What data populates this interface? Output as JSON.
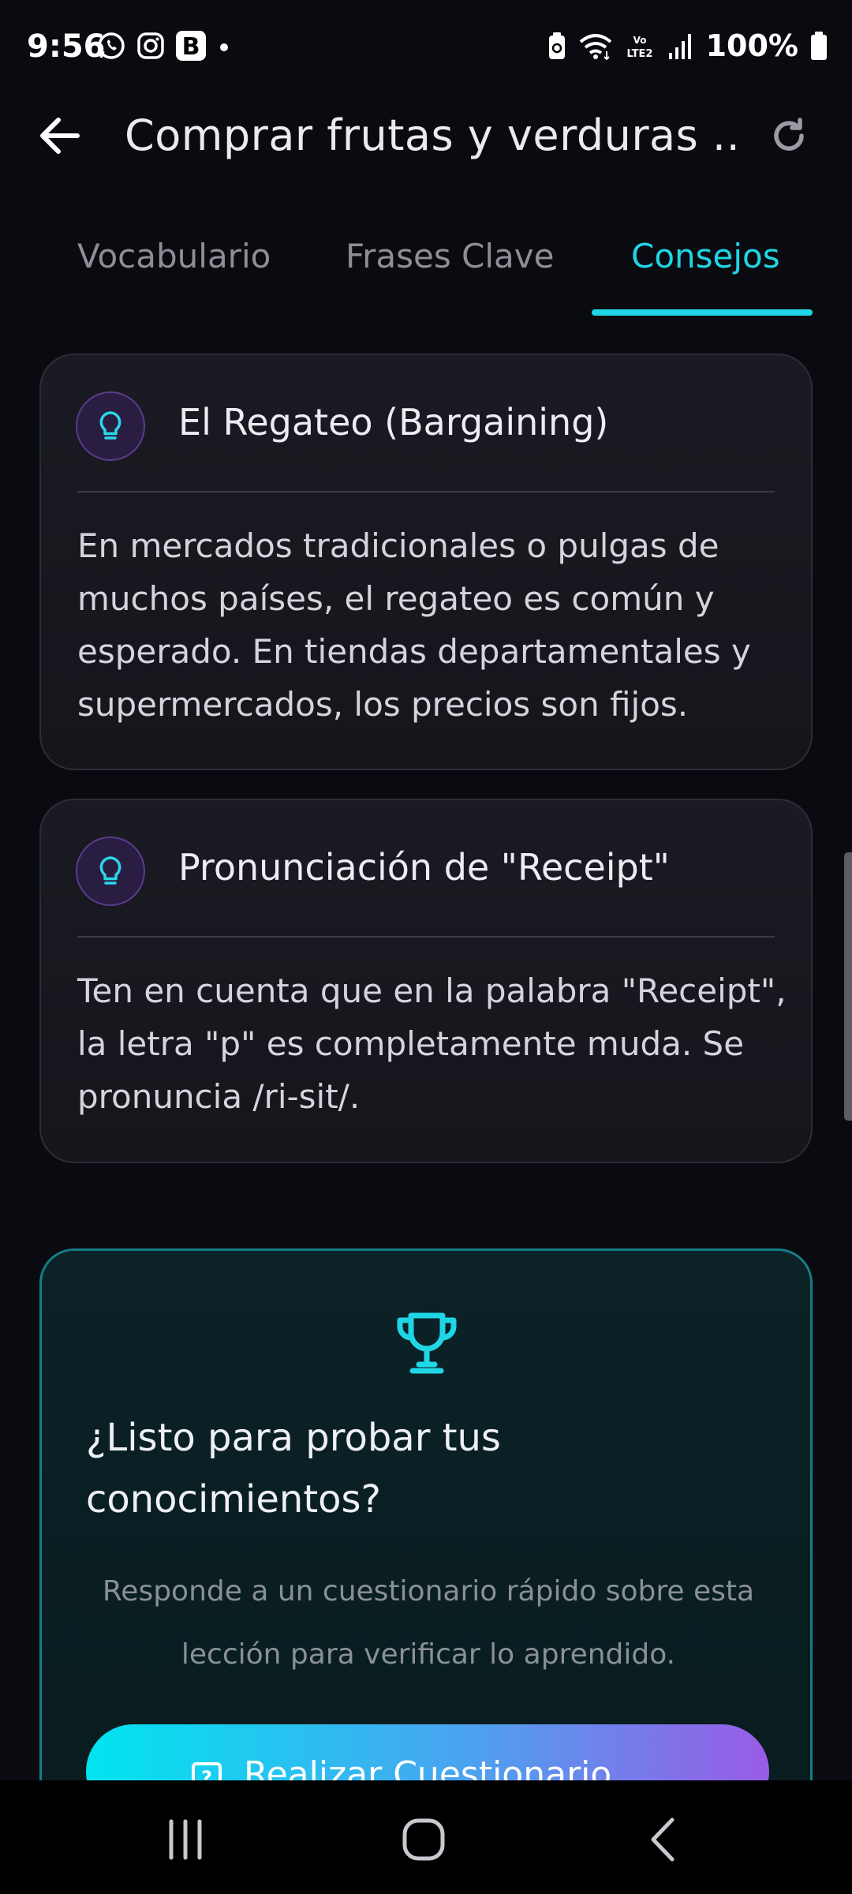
{
  "status_bar": {
    "time": "9:56",
    "notification_icons": [
      "whatsapp-icon",
      "instagram-icon",
      "b-app-icon",
      "dot-icon"
    ],
    "system_icons": [
      "battery-saver-icon",
      "wifi-icon",
      "volte-icon",
      "signal-icon"
    ],
    "volte_label": "Vo LTE2",
    "battery_text": "100%"
  },
  "app_bar": {
    "title": "Comprar frutas y verduras ...",
    "back_icon": "arrow-left-icon",
    "refresh_icon": "refresh-icon"
  },
  "tabs": [
    {
      "label": "Vocabulario",
      "active": false
    },
    {
      "label": "Frases Clave",
      "active": false
    },
    {
      "label": "Consejos",
      "active": true
    }
  ],
  "tips": [
    {
      "icon": "lightbulb-icon",
      "title": "El Regateo (Bargaining)",
      "body": "En mercados tradicionales o pulgas de muchos países, el regateo es común y esperado. En tiendas departamentales y supermercados, los precios son fijos."
    },
    {
      "icon": "lightbulb-icon",
      "title": "Pronunciación de \"Receipt\"",
      "body": "Ten en cuenta que en la palabra \"Receipt\", la letra \"p\" es completamente muda. Se pronuncia /ri-sit/."
    }
  ],
  "quiz": {
    "icon": "trophy-icon",
    "title": "¿Listo para probar tus conocimientos?",
    "description": "Responde a un cuestionario rápido sobre esta lección para verificar lo aprendido.",
    "button_label": "Realizar Cuestionario",
    "button_icon": "quiz-icon"
  },
  "colors": {
    "accent": "#1fd6e6",
    "background": "#0a0b10",
    "card": "#1a1a22",
    "icon_purple": "#5b3b8e",
    "quiz_border": "#157d86"
  },
  "nav_bar": {
    "buttons": [
      "recent-apps-icon",
      "home-icon",
      "back-icon"
    ]
  }
}
